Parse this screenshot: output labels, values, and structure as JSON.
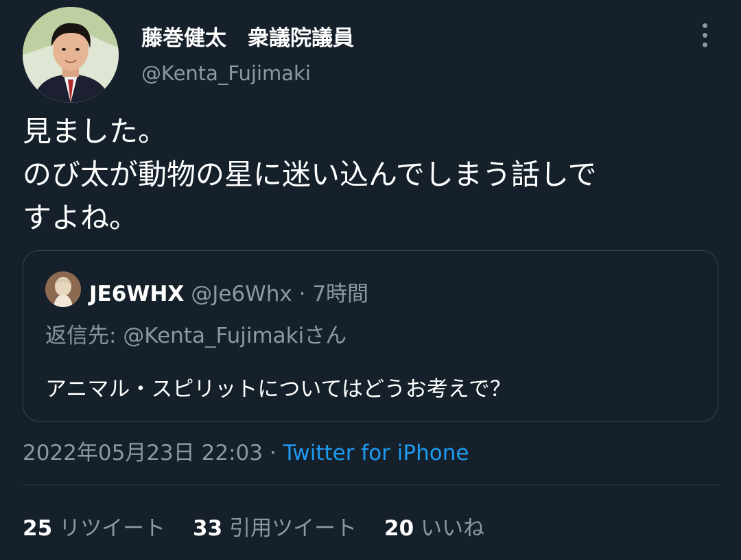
{
  "author": {
    "display_name": "藤巻健太　衆議院議員",
    "handle": "@Kenta_Fujimaki"
  },
  "tweet": {
    "lines": [
      "見ました。",
      "のび太が動物の星に迷い込んでしまう話しで",
      "すよね。"
    ]
  },
  "quoted_tweet": {
    "name": "JE6WHX",
    "handle_time": "@Je6Whx · 7時間",
    "reply_to": "返信先: @Kenta_Fujimakiさん",
    "text": "アニマル・スピリットについてはどうお考えで？"
  },
  "meta": {
    "timestamp": "2022年05月23日 22:03 · ",
    "source": "Twitter for iPhone"
  },
  "stats": {
    "retweets_count": "25",
    "retweets_label": "リツイート",
    "quotes_count": "33",
    "quotes_label": "引用ツイート",
    "likes_count": "20",
    "likes_label": "いいね"
  },
  "colors": {
    "background": "#15202b",
    "text": "#ffffff",
    "secondary": "#8b98a5",
    "link": "#1d9bf0",
    "border": "#38444d"
  },
  "icons": {
    "more": "more-vertical-icon"
  }
}
